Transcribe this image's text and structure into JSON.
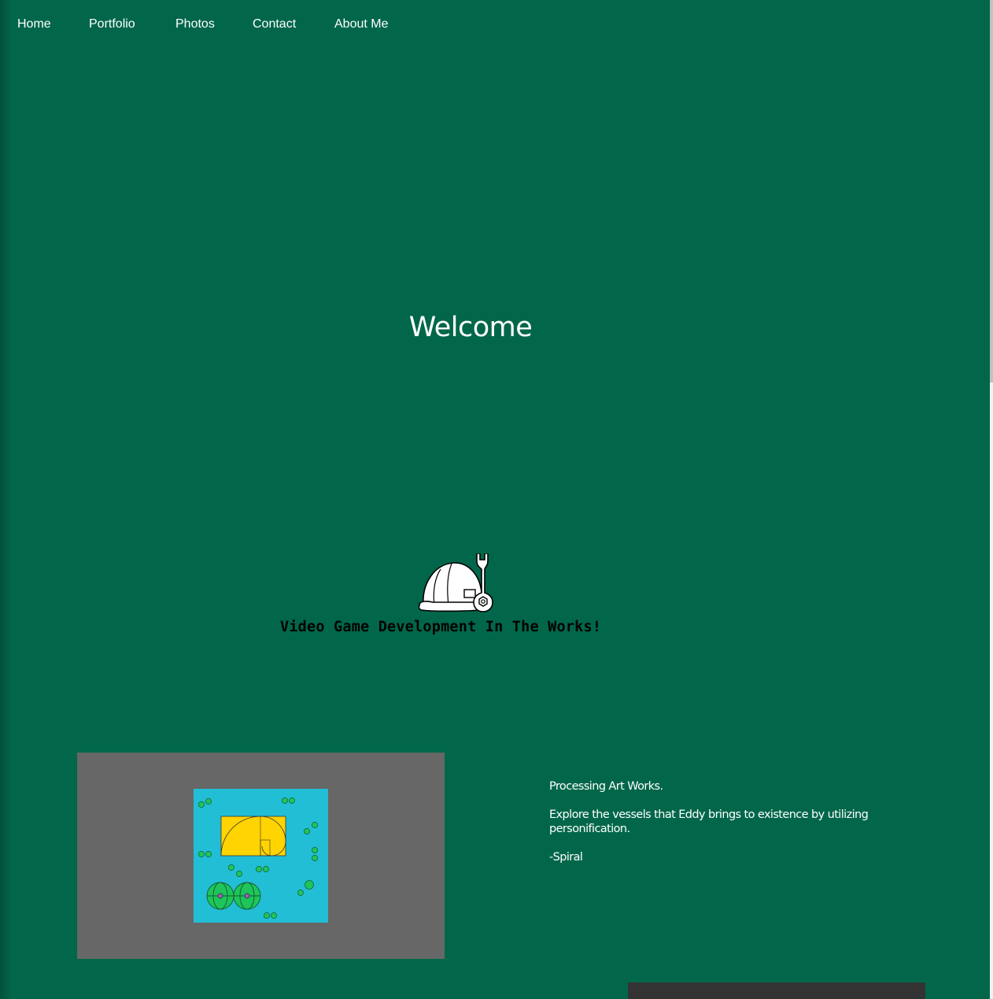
{
  "nav": {
    "items": [
      {
        "label": "Home"
      },
      {
        "label": "Portfolio"
      },
      {
        "label": "Photos"
      },
      {
        "label": "Contact"
      },
      {
        "label": "About Me"
      }
    ]
  },
  "hero": {
    "title": "Welcome"
  },
  "construction": {
    "icon": "construction-helmet-wrench-icon",
    "label": "Video Game Development In The Works!"
  },
  "art_section": {
    "image": "processing-art-spiral-image",
    "heading": "Processing Art Works.",
    "description": "Explore the vessels that Eddy brings to existence by utilizing personification.",
    "signature": "-Spiral"
  },
  "colors": {
    "background": "#02674a",
    "art_frame": "#676767",
    "art_canvas": "#22bed6",
    "art_rect": "#ffd400",
    "art_circles": "#1ec55a"
  }
}
